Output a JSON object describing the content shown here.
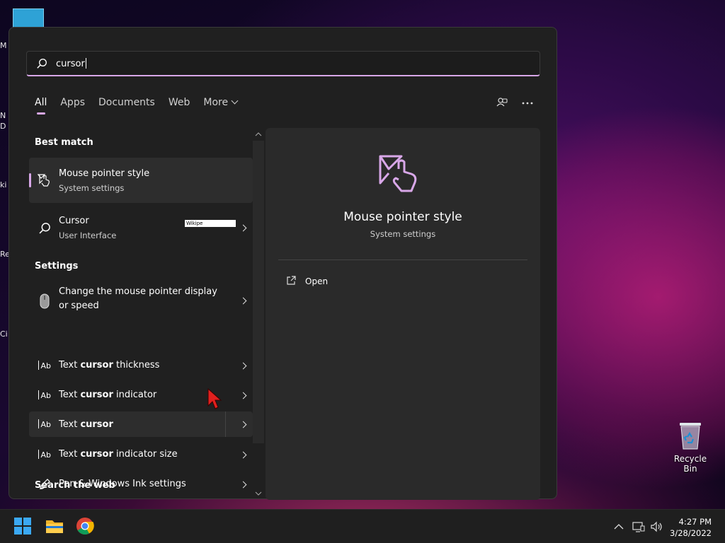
{
  "desktop": {
    "left_icon_fragments": [
      "M",
      "N\nD",
      "ki",
      "Re",
      "Ci"
    ],
    "recycle_bin": {
      "label": "Recycle Bin",
      "icon": "recycle-bin-icon"
    }
  },
  "search": {
    "query": "cursor",
    "icon": "search-icon"
  },
  "tabs": [
    {
      "label": "All",
      "active": true
    },
    {
      "label": "Apps"
    },
    {
      "label": "Documents"
    },
    {
      "label": "Web"
    },
    {
      "label": "More"
    }
  ],
  "toolbar": {
    "account_icon": "people-switch-icon",
    "more_icon": "more-options-icon"
  },
  "results": {
    "best_match_header": "Best match",
    "best_match": {
      "title": "Mouse pointer style",
      "subtitle": "System settings",
      "icon": "mouse-pointer-style-icon"
    },
    "web_item": {
      "title": "Cursor",
      "subtitle": "User Interface",
      "preview_text": "Wikipe",
      "icon": "search-icon"
    },
    "settings_header": "Settings",
    "settings_items": [
      {
        "pre": "Change the mouse pointer display",
        "line2": "or speed",
        "icon": "mouse-icon"
      },
      {
        "pre": "Text ",
        "bold": "cursor",
        "post": " thickness",
        "icon": "text-cursor-icon"
      },
      {
        "pre": "Text ",
        "bold": "cursor",
        "post": " indicator",
        "icon": "text-cursor-icon"
      },
      {
        "pre": "Text ",
        "bold": "cursor",
        "post": "",
        "icon": "text-cursor-icon",
        "hovered": true
      },
      {
        "pre": "Text ",
        "bold": "cursor",
        "post": " indicator size",
        "icon": "text-cursor-icon"
      },
      {
        "pre": "Pen & Windows Ink settings",
        "icon": "pen-icon"
      }
    ],
    "web_header": "Search the web",
    "ab_glyph": "Ab"
  },
  "preview": {
    "title": "Mouse pointer style",
    "subtitle": "System settings",
    "icon": "mouse-pointer-style-icon",
    "actions": [
      {
        "label": "Open",
        "icon": "open-external-icon"
      }
    ]
  },
  "taskbar": {
    "apps": [
      {
        "name": "start-button"
      },
      {
        "name": "file-explorer"
      },
      {
        "name": "chrome"
      }
    ],
    "time": "4:27 PM",
    "date": "3/28/2022"
  },
  "colors": {
    "accent": "#d8a7e8",
    "panel": "#202020",
    "preview_pane": "#2a2a2a"
  }
}
